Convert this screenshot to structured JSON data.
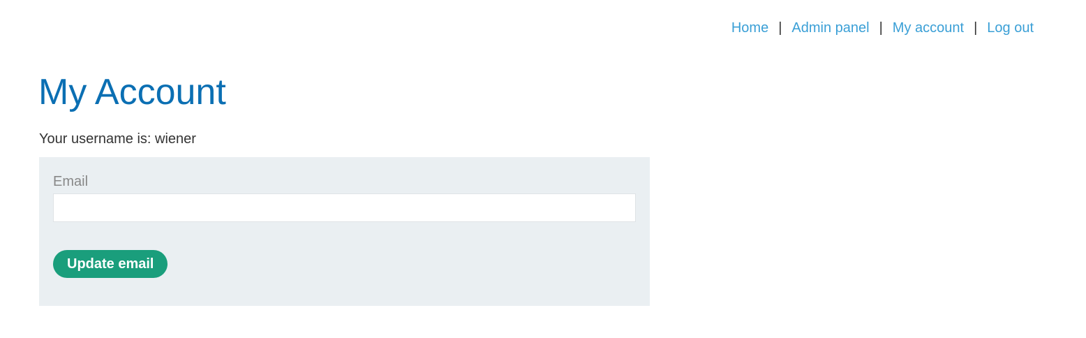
{
  "nav": {
    "items": [
      {
        "label": "Home"
      },
      {
        "label": "Admin panel"
      },
      {
        "label": "My account"
      },
      {
        "label": "Log out"
      }
    ],
    "separator": "|"
  },
  "main": {
    "title": "My Account",
    "username_line": "Your username is: wiener"
  },
  "form": {
    "email_label": "Email",
    "email_value": "",
    "email_placeholder": "",
    "submit_label": "Update email"
  },
  "colors": {
    "link": "#3a9fd6",
    "title": "#0b6fb3",
    "form_background": "#eaeff2",
    "button": "#1a9e7c"
  }
}
